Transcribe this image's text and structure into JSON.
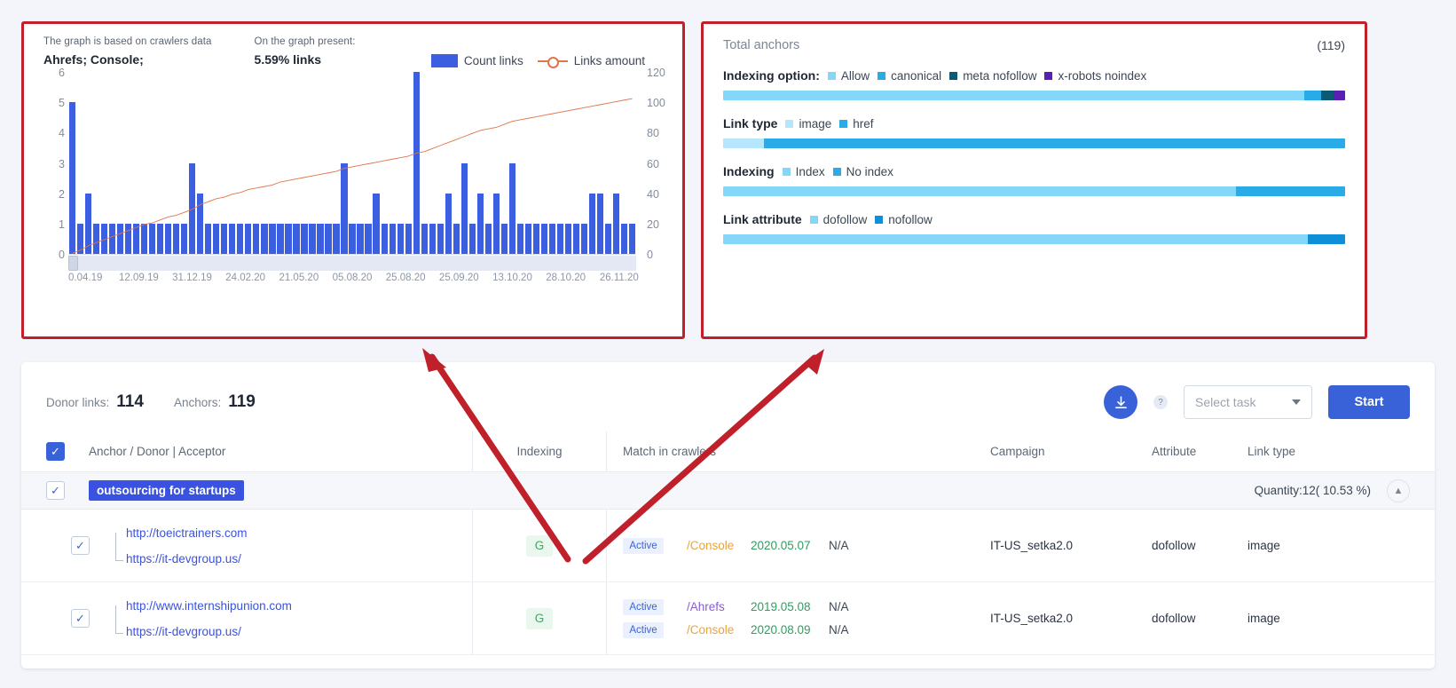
{
  "chart_panel": {
    "note_caption": "The graph is based on crawlers data",
    "note_value": "Ahrefs; Console;",
    "present_caption": "On the graph present:",
    "present_value": "5.59% links",
    "legend": [
      {
        "label": "Count links",
        "type": "bar",
        "color": "#3c5ee0"
      },
      {
        "label": "Links amount",
        "type": "line",
        "color": "#e0744a"
      }
    ]
  },
  "chart_data": {
    "type": "bar",
    "title": "",
    "xlabel": "",
    "ylabel": "Count links",
    "y2label": "Links amount",
    "ylim": [
      0,
      6
    ],
    "y2lim": [
      0,
      120
    ],
    "yticks": [
      0,
      1,
      2,
      3,
      4,
      5,
      6
    ],
    "y2ticks": [
      0,
      20,
      40,
      60,
      80,
      100,
      120
    ],
    "grid": false,
    "legend_position": "top-right",
    "tick_labels": [
      "0.04.19",
      "12.09.19",
      "31.12.19",
      "24.02.20",
      "21.05.20",
      "05.08.20",
      "25.08.20",
      "25.09.20",
      "13.10.20",
      "28.10.20",
      "26.11.20"
    ],
    "series": [
      {
        "name": "Count links",
        "type": "bar",
        "axis": "left",
        "values": [
          5,
          1,
          2,
          1,
          1,
          1,
          1,
          1,
          1,
          1,
          1,
          1,
          1,
          1,
          1,
          3,
          2,
          1,
          1,
          1,
          1,
          1,
          1,
          1,
          1,
          1,
          1,
          1,
          1,
          1,
          1,
          1,
          1,
          1,
          3,
          1,
          1,
          1,
          2,
          1,
          1,
          1,
          1,
          6,
          1,
          1,
          1,
          2,
          1,
          3,
          1,
          2,
          1,
          2,
          1,
          3,
          1,
          1,
          1,
          1,
          1,
          1,
          1,
          1,
          1,
          2,
          2,
          1,
          2,
          1,
          1
        ]
      },
      {
        "name": "Links amount",
        "type": "line",
        "axis": "right",
        "values": [
          1,
          3,
          6,
          8,
          10,
          12,
          14,
          16,
          18,
          20,
          21,
          23,
          25,
          26,
          28,
          30,
          33,
          35,
          37,
          38,
          40,
          41,
          43,
          44,
          45,
          46,
          48,
          49,
          50,
          51,
          52,
          53,
          54,
          55,
          57,
          58,
          59,
          60,
          61,
          62,
          63,
          64,
          65,
          67,
          68,
          70,
          72,
          74,
          76,
          78,
          80,
          82,
          83,
          84,
          86,
          88,
          89,
          90,
          91,
          92,
          93,
          94,
          95,
          96,
          97,
          98,
          99,
          100,
          101,
          102,
          103
        ]
      }
    ]
  },
  "anchors_panel": {
    "title": "Total anchors",
    "count": "(119)",
    "metrics": [
      {
        "name": "Indexing option:",
        "legend": [
          {
            "label": "Allow",
            "color": "#85d7fa"
          },
          {
            "label": "canonical",
            "color": "#29abe8"
          },
          {
            "label": "meta nofollow",
            "color": "#0b5a74"
          },
          {
            "label": "x-robots noindex",
            "color": "#5b1fb5"
          }
        ],
        "segments": [
          {
            "color": "#85d7fa",
            "pct": 93.5
          },
          {
            "color": "#29abe8",
            "pct": 2.6
          },
          {
            "color": "#0b5a74",
            "pct": 2.0
          },
          {
            "color": "#5b1fb5",
            "pct": 1.9
          }
        ]
      },
      {
        "name": "Link type",
        "legend": [
          {
            "label": "image",
            "color": "#b5e6fb"
          },
          {
            "label": "href",
            "color": "#29abe8"
          }
        ],
        "segments": [
          {
            "color": "#b5e6fb",
            "pct": 6.5
          },
          {
            "color": "#29abe8",
            "pct": 93.5
          }
        ]
      },
      {
        "name": "Indexing",
        "legend": [
          {
            "label": "Index",
            "color": "#85d7fa"
          },
          {
            "label": "No index",
            "color": "#29abe8"
          }
        ],
        "segments": [
          {
            "color": "#85d7fa",
            "pct": 82.5
          },
          {
            "color": "#29abe8",
            "pct": 17.5
          }
        ]
      },
      {
        "name": "Link attribute",
        "legend": [
          {
            "label": "dofollow",
            "color": "#85d7fa"
          },
          {
            "label": "nofollow",
            "color": "#0e8fd8"
          }
        ],
        "segments": [
          {
            "color": "#85d7fa",
            "pct": 94.0
          },
          {
            "color": "#0e8fd8",
            "pct": 6.0
          }
        ]
      }
    ]
  },
  "table_card": {
    "stats": {
      "donor_links_label": "Donor links:",
      "donor_links_value": "114",
      "anchors_label": "Anchors:",
      "anchors_value": "119"
    },
    "toolbar": {
      "download_icon": "download-icon",
      "help_icon": "question-icon",
      "select_task_value": "Select task",
      "start_label": "Start"
    },
    "columns": [
      "Anchor / Donor | Acceptor",
      "Indexing",
      "Match in crawlers",
      "Campaign",
      "Attribute",
      "Link type"
    ],
    "group": {
      "anchor": "outsourcing for startups",
      "quantity": "Quantity:12( 10.53 %)",
      "collapse_icon": "chevron-up-icon"
    },
    "rows": [
      {
        "donor": "http://toeictrainers.com",
        "acceptor": "https://it-devgroup.us/",
        "indexing": "G",
        "matches": [
          {
            "status": "Active",
            "crawler": "/Console",
            "crawler_color": "#e8a33d",
            "date": "2020.05.07",
            "na": "N/A"
          }
        ],
        "campaign": "IT-US_setka2.0",
        "attribute": "dofollow",
        "link_type": "image"
      },
      {
        "donor": "http://www.internshipunion.com",
        "acceptor": "https://it-devgroup.us/",
        "indexing": "G",
        "matches": [
          {
            "status": "Active",
            "crawler": "/Ahrefs",
            "crawler_color": "#8a5bd6",
            "date": "2019.05.08",
            "na": "N/A"
          },
          {
            "status": "Active",
            "crawler": "/Console",
            "crawler_color": "#e8a33d",
            "date": "2020.08.09",
            "na": "N/A"
          }
        ],
        "campaign": "IT-US_setka2.0",
        "attribute": "dofollow",
        "link_type": "image"
      }
    ]
  },
  "annotations": {
    "arrow_color": "#c0202a",
    "arrows": 2
  }
}
